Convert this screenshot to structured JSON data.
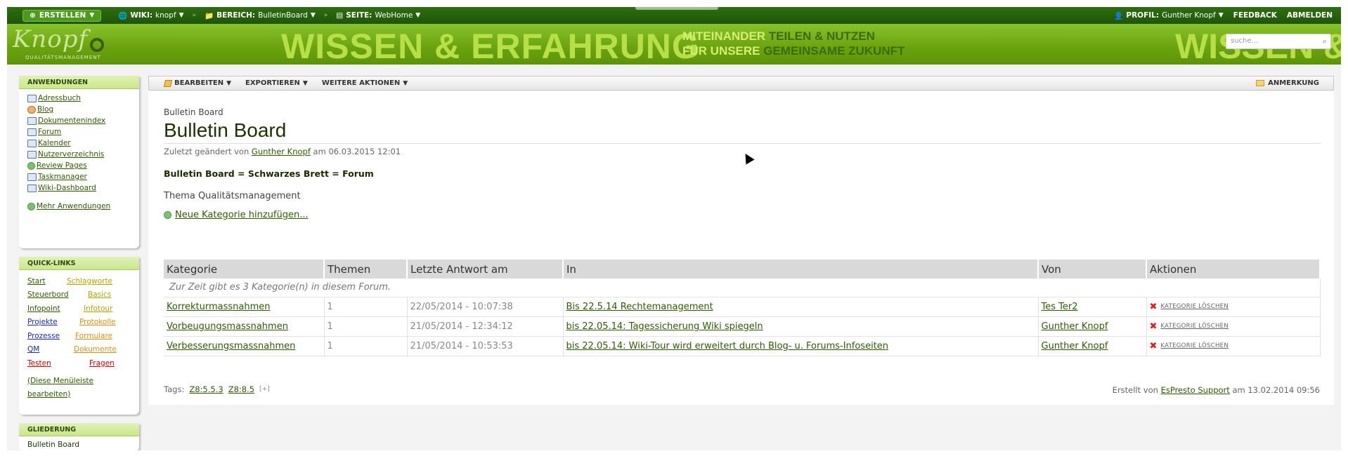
{
  "topbar": {
    "create": "ERSTELLEN",
    "wiki_label": "WIKI:",
    "wiki_value": "knopf",
    "area_label": "BEREICH:",
    "area_value": "BulletinBoard",
    "page_label": "SEITE:",
    "page_value": "WebHome",
    "profile_label": "PROFIL:",
    "profile_value": "Gunther Knopf",
    "feedback": "FEEDBACK",
    "logout": "ABMELDEN"
  },
  "banner": {
    "logo_word": "Knopf",
    "logo_sub": "QUALITÄTSMANAGEMENT",
    "slogan": "WISSEN & ERFAHRUNG",
    "line1_a": "MITEINANDER",
    "line1_b": "TEILEN & NUTZEN",
    "line2_a": "FÜR UNSERE",
    "line2_b": "GEMEINSAME ZUKUNFT",
    "slogan_repeat": "WISSEN &",
    "search_placeholder": "suche..."
  },
  "sidebar": {
    "apps_title": "ANWENDUNGEN",
    "apps": [
      {
        "label": "Adressbuch",
        "icon": "address-book-icon"
      },
      {
        "label": "Blog",
        "icon": "blog-icon"
      },
      {
        "label": "Dokumentenindex",
        "icon": "document-index-icon"
      },
      {
        "label": "Forum",
        "icon": "forum-icon"
      },
      {
        "label": "Kalender",
        "icon": "calendar-icon"
      },
      {
        "label": "Nutzerverzeichnis",
        "icon": "users-icon"
      },
      {
        "label": "Review Pages",
        "icon": "review-icon"
      },
      {
        "label": "Taskmanager",
        "icon": "task-icon"
      },
      {
        "label": "Wiki-Dashboard",
        "icon": "dashboard-icon"
      }
    ],
    "more_apps": "Mehr Anwendungen",
    "quick_title": "QUICK-LINKS",
    "quick": [
      {
        "left": "Start",
        "right": "Schlagworte",
        "lc": "green",
        "rc": "yellow"
      },
      {
        "left": "Steuerbord",
        "right": "Basics",
        "lc": "green",
        "rc": "yellow"
      },
      {
        "left": "Infopoint",
        "right": "Infotour",
        "lc": "green",
        "rc": "yellow"
      },
      {
        "left": "Projekte",
        "right": "Protokolle",
        "lc": "blue",
        "rc": "orange"
      },
      {
        "left": "Prozesse",
        "right": "Formulare",
        "lc": "blue",
        "rc": "orange"
      },
      {
        "left": "QM",
        "right": "Dokumente",
        "lc": "blue",
        "rc": "orange"
      },
      {
        "left": "Testen",
        "right": "Fragen",
        "lc": "red",
        "rc": "red"
      }
    ],
    "edit_menu": "(Diese Menüleiste bearbeiten)",
    "outline_title": "GLIEDERUNG",
    "outline_item": "Bulletin Board"
  },
  "toolbar": {
    "edit": "BEARBEITEN",
    "export": "EXPORTIEREN",
    "more": "WEITERE AKTIONEN",
    "comment": "ANMERKUNG"
  },
  "page": {
    "breadcrumb": "Bulletin Board",
    "title": "Bulletin Board",
    "changed_prefix": "Zuletzt geändert von",
    "changed_user": "Gunther Knopf",
    "changed_suffix": "am 06.03.2015 12:01",
    "bold_line": "Bulletin Board = Schwarzes Brett = Forum",
    "thema": "Thema Qualitätsmanagement",
    "new_category": "Neue Kategorie hinzufügen..."
  },
  "table": {
    "headers": [
      "Kategorie",
      "Themen",
      "Letzte Antwort am",
      "In",
      "Von",
      "Aktionen"
    ],
    "info": "Zur Zeit gibt es 3 Kategorie(n) in diesem Forum.",
    "rows": [
      {
        "cat": "Korrekturmassnahmen",
        "count": "1",
        "date": "22/05/2014 - 10:07:38",
        "in": "Bis 22.5.14 Rechtemanagement",
        "by": "Tes Ter2",
        "action": "KATEGORIE LÖSCHEN"
      },
      {
        "cat": "Vorbeugungsmassnahmen",
        "count": "1",
        "date": "21/05/2014 - 12:34:12",
        "in": "bis 22.05.14: Tagessicherung Wiki spiegeln",
        "by": "Gunther Knopf",
        "action": "KATEGORIE LÖSCHEN"
      },
      {
        "cat": "Verbesserungsmassnahmen",
        "count": "1",
        "date": "21/05/2014 - 10:53:53",
        "in": "bis 22.05.14: Wiki-Tour wird erweitert durch Blog- u. Forums-Infoseiten",
        "by": "Gunther Knopf",
        "action": "KATEGORIE LÖSCHEN"
      }
    ]
  },
  "footer": {
    "tags_label": "Tags:",
    "tags": [
      "Z8:5.5.3",
      "Z8:8.5"
    ],
    "tags_add": "[+]",
    "created_prefix": "Erstellt von",
    "created_user": "EsPresto Support",
    "created_suffix": "am 13.02.2014 09:56"
  },
  "colors": {
    "brand_green": "#6aa20f",
    "topbar_green": "#2f6e12",
    "link_green": "#2e5c00"
  }
}
